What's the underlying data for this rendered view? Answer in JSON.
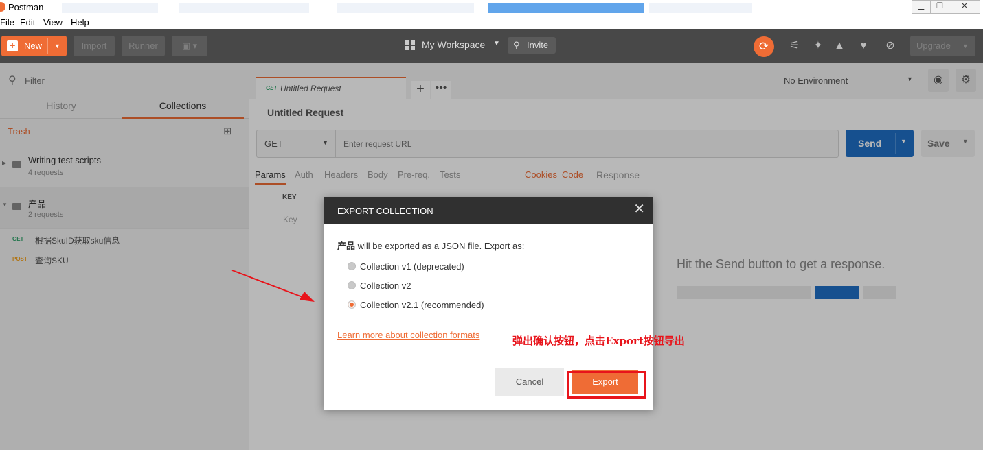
{
  "window": {
    "title": "Postman",
    "controls": {
      "minimize": "▁",
      "restore": "❐",
      "close": "✕"
    }
  },
  "menu": [
    "File",
    "Edit",
    "View",
    "Help"
  ],
  "header": {
    "new_label": "New",
    "import_label": "Import",
    "runner_label": "Runner",
    "workspace_label": "My Workspace",
    "invite_label": "Invite",
    "upgrade_label": "Upgrade",
    "icons": [
      "sync-icon",
      "satellite-icon",
      "wrench-icon",
      "bell-icon",
      "heart-icon",
      "planet-icon"
    ]
  },
  "sidebar": {
    "filter_placeholder": "Filter",
    "tabs": [
      "History",
      "Collections"
    ],
    "active_tab": "Collections",
    "trash_label": "Trash",
    "collections": [
      {
        "name": "Writing test scripts",
        "count": "4 requests"
      },
      {
        "name": "产品",
        "count": "2 requests"
      }
    ],
    "requests": [
      {
        "method": "GET",
        "name": "根据SkuID获取sku信息",
        "color": "#2fa36a"
      },
      {
        "method": "POST",
        "name": "查询SKU",
        "color": "#f4a31f"
      }
    ]
  },
  "main": {
    "tab": {
      "method": "GET",
      "name": "Untitled Request"
    },
    "request_title": "Untitled Request",
    "method": "GET",
    "url_placeholder": "Enter request URL",
    "send_label": "Send",
    "save_label": "Save",
    "environment": "No Environment",
    "subtabs": [
      "Params",
      "Auth",
      "Headers",
      "Body",
      "Pre-req.",
      "Tests"
    ],
    "cookies_label": "Cookies",
    "code_label": "Code",
    "response_label": "Response",
    "params_key_header": "KEY",
    "params_key_placeholder": "Key",
    "response_hint": "Hit the Send button to get a response."
  },
  "modal": {
    "title": "EXPORT COLLECTION",
    "collection_name": "产品",
    "message": " will be exported as a JSON file. Export as:",
    "options": [
      "Collection v1 (deprecated)",
      "Collection v2",
      "Collection v2.1 (recommended)"
    ],
    "selected_option": 2,
    "learn_more": "Learn more about collection formats",
    "cancel_label": "Cancel",
    "export_label": "Export"
  },
  "annotation": "弹出确认按钮，点击Export按钮导出",
  "colors": {
    "accent": "#ef6c35",
    "send": "#1f70c7",
    "annotation": "#e8141b"
  }
}
